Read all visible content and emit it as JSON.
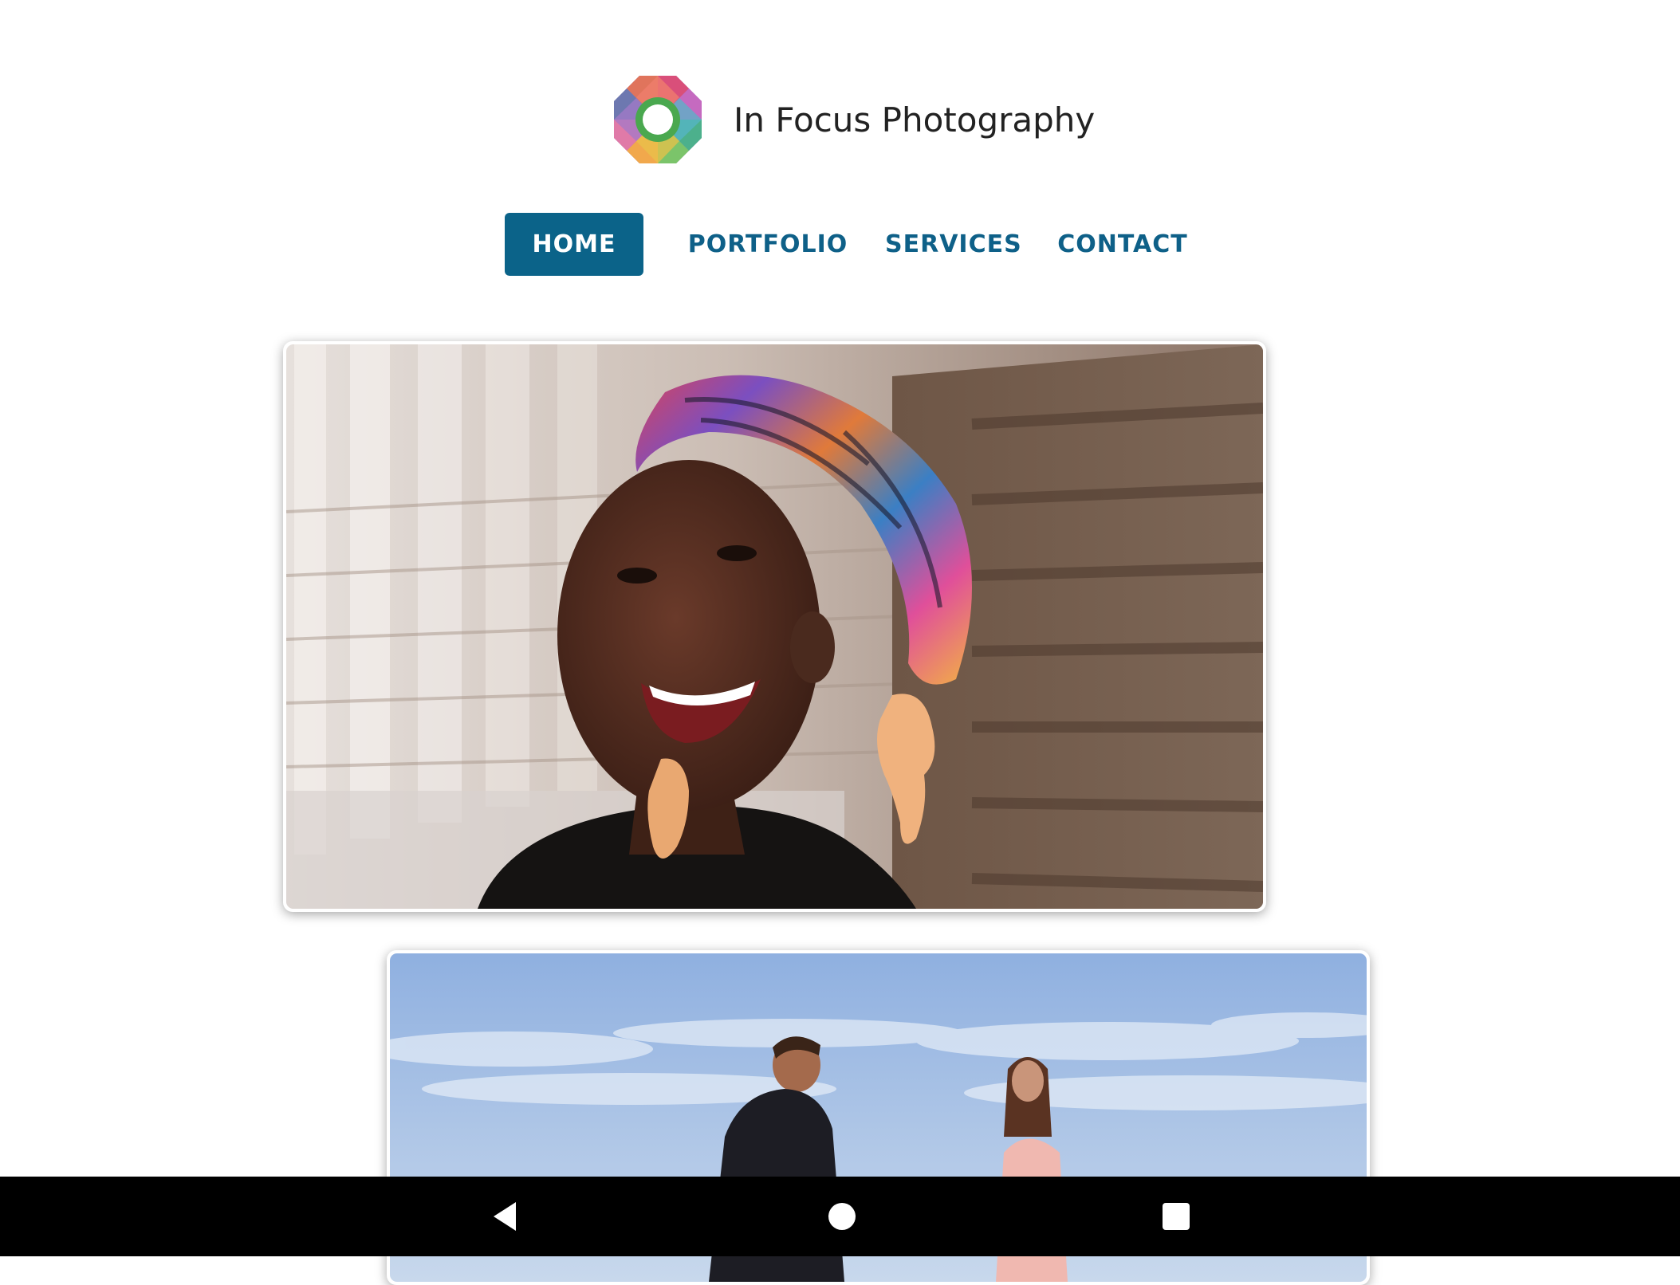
{
  "site": {
    "title": "In Focus Photography",
    "logo_icon": "camera-aperture-logo-icon"
  },
  "nav": {
    "items": [
      {
        "label": "HOME",
        "active": true
      },
      {
        "label": "PORTFOLIO",
        "active": false
      },
      {
        "label": "SERVICES",
        "active": false
      },
      {
        "label": "CONTACT",
        "active": false
      }
    ]
  },
  "gallery": {
    "photos": [
      {
        "subject": "portrait-photo"
      },
      {
        "subject": "beach-couple-photo"
      }
    ]
  },
  "system_nav": {
    "back_icon": "back-triangle-icon",
    "home_icon": "home-circle-icon",
    "recents_icon": "recents-square-icon"
  },
  "colors": {
    "accent": "#0b6389",
    "nav_text": "#0e6088",
    "title_text": "#222222",
    "system_bar": "#000000"
  }
}
